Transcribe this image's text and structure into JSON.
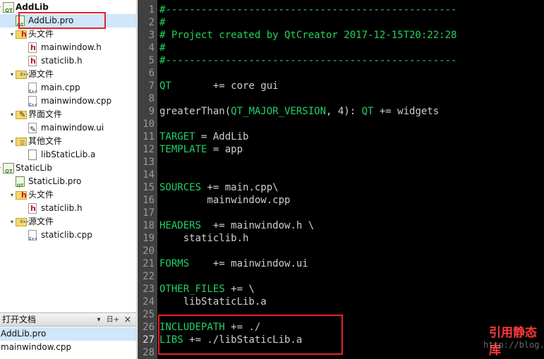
{
  "project_tree": {
    "rows": [
      {
        "label": "AddLib",
        "level": 0,
        "icon": "qt-project-icon",
        "arrow": "▾",
        "bold": true
      },
      {
        "label": "AddLib.pro",
        "level": 1,
        "icon": "pro-file-icon",
        "selected": true
      },
      {
        "label": "头文件",
        "level": 1,
        "icon": "header-folder-icon",
        "arrow": "▾"
      },
      {
        "label": "mainwindow.h",
        "level": 2,
        "icon": "header-file-icon"
      },
      {
        "label": "staticlib.h",
        "level": 2,
        "icon": "header-file-icon"
      },
      {
        "label": "源文件",
        "level": 1,
        "icon": "source-folder-icon",
        "arrow": "▾"
      },
      {
        "label": "main.cpp",
        "level": 2,
        "icon": "cpp-file-icon"
      },
      {
        "label": "mainwindow.cpp",
        "level": 2,
        "icon": "cpp-file-icon"
      },
      {
        "label": "界面文件",
        "level": 1,
        "icon": "form-folder-icon",
        "arrow": "▾"
      },
      {
        "label": "mainwindow.ui",
        "level": 2,
        "icon": "ui-file-icon"
      },
      {
        "label": "其他文件",
        "level": 1,
        "icon": "other-folder-icon",
        "arrow": "▾"
      },
      {
        "label": "libStaticLib.a",
        "level": 2,
        "icon": "file-icon"
      },
      {
        "label": "StaticLib",
        "level": 0,
        "icon": "qt-project-icon",
        "arrow": "▾"
      },
      {
        "label": "StaticLib.pro",
        "level": 1,
        "icon": "pro-file-icon"
      },
      {
        "label": "头文件",
        "level": 1,
        "icon": "header-folder-icon",
        "arrow": "▾"
      },
      {
        "label": "staticlib.h",
        "level": 2,
        "icon": "header-file-icon"
      },
      {
        "label": "源文件",
        "level": 1,
        "icon": "source-folder-icon",
        "arrow": "▾"
      },
      {
        "label": "staticlib.cpp",
        "level": 2,
        "icon": "cpp-file-icon"
      }
    ]
  },
  "open_documents": {
    "title": "打开文档",
    "dropdown_icon": "▾",
    "split_icon": "日+",
    "close_icon": "×",
    "items": [
      {
        "label": "AddLib.pro",
        "selected": true
      },
      {
        "label": "mainwindow.cpp"
      }
    ]
  },
  "editor": {
    "current_line": 27,
    "lines": [
      {
        "n": "1",
        "parts": [
          {
            "t": "#-------------------------------------------------",
            "c": "comment"
          }
        ]
      },
      {
        "n": "2",
        "parts": [
          {
            "t": "#",
            "c": "comment"
          }
        ]
      },
      {
        "n": "3",
        "parts": [
          {
            "t": "# Project created by QtCreator 2017-12-15T20:22:28",
            "c": "comment"
          }
        ]
      },
      {
        "n": "4",
        "parts": [
          {
            "t": "#",
            "c": "comment"
          }
        ]
      },
      {
        "n": "5",
        "parts": [
          {
            "t": "#-------------------------------------------------",
            "c": "comment"
          }
        ]
      },
      {
        "n": "6",
        "parts": []
      },
      {
        "n": "7",
        "parts": [
          {
            "t": "QT",
            "c": "kw"
          },
          {
            "t": "       += core gui",
            "c": "plain"
          }
        ]
      },
      {
        "n": "8",
        "parts": []
      },
      {
        "n": "9",
        "parts": [
          {
            "t": "greaterThan(",
            "c": "plain"
          },
          {
            "t": "QT_MAJOR_VERSION",
            "c": "kw"
          },
          {
            "t": ", 4): ",
            "c": "plain"
          },
          {
            "t": "QT",
            "c": "kw"
          },
          {
            "t": " += widgets",
            "c": "plain"
          }
        ]
      },
      {
        "n": "10",
        "parts": []
      },
      {
        "n": "11",
        "parts": [
          {
            "t": "TARGET",
            "c": "kw"
          },
          {
            "t": " = AddLib",
            "c": "plain"
          }
        ]
      },
      {
        "n": "12",
        "parts": [
          {
            "t": "TEMPLATE",
            "c": "kw"
          },
          {
            "t": " = app",
            "c": "plain"
          }
        ]
      },
      {
        "n": "13",
        "parts": []
      },
      {
        "n": "14",
        "parts": []
      },
      {
        "n": "15",
        "parts": [
          {
            "t": "SOURCES",
            "c": "kw"
          },
          {
            "t": " += main.cpp\\",
            "c": "plain"
          }
        ]
      },
      {
        "n": "16",
        "parts": [
          {
            "t": "        mainwindow.cpp",
            "c": "plain"
          }
        ]
      },
      {
        "n": "17",
        "parts": []
      },
      {
        "n": "18",
        "parts": [
          {
            "t": "HEADERS",
            "c": "kw"
          },
          {
            "t": "  += mainwindow.h \\",
            "c": "plain"
          }
        ]
      },
      {
        "n": "19",
        "parts": [
          {
            "t": "    staticlib.h",
            "c": "plain"
          }
        ]
      },
      {
        "n": "20",
        "parts": []
      },
      {
        "n": "21",
        "parts": [
          {
            "t": "FORMS",
            "c": "kw"
          },
          {
            "t": "    += mainwindow.ui",
            "c": "plain"
          }
        ]
      },
      {
        "n": "22",
        "parts": []
      },
      {
        "n": "23",
        "parts": [
          {
            "t": "OTHER_FILES",
            "c": "kw"
          },
          {
            "t": " += \\",
            "c": "plain"
          }
        ]
      },
      {
        "n": "24",
        "parts": [
          {
            "t": "    libStaticLib.a",
            "c": "plain"
          }
        ]
      },
      {
        "n": "25",
        "parts": []
      },
      {
        "n": "26",
        "parts": [
          {
            "t": "INCLUDEPATH",
            "c": "kw"
          },
          {
            "t": " += ./",
            "c": "plain"
          }
        ]
      },
      {
        "n": "27",
        "parts": [
          {
            "t": "LIBS",
            "c": "kw"
          },
          {
            "t": " += ./libStaticLib.a",
            "c": "plain"
          }
        ]
      },
      {
        "n": "28",
        "parts": []
      }
    ],
    "annotation": "引用静态库",
    "watermark": "http://blog.csdn.net/ALONE_WORK"
  },
  "colors": {
    "comment": "#22d45b",
    "keyword": "#21d06a",
    "plain": "#cfcfcf",
    "highlight_box": "#e8202a",
    "annotation": "#ff3a3a",
    "selection": "#cfe6fb"
  }
}
